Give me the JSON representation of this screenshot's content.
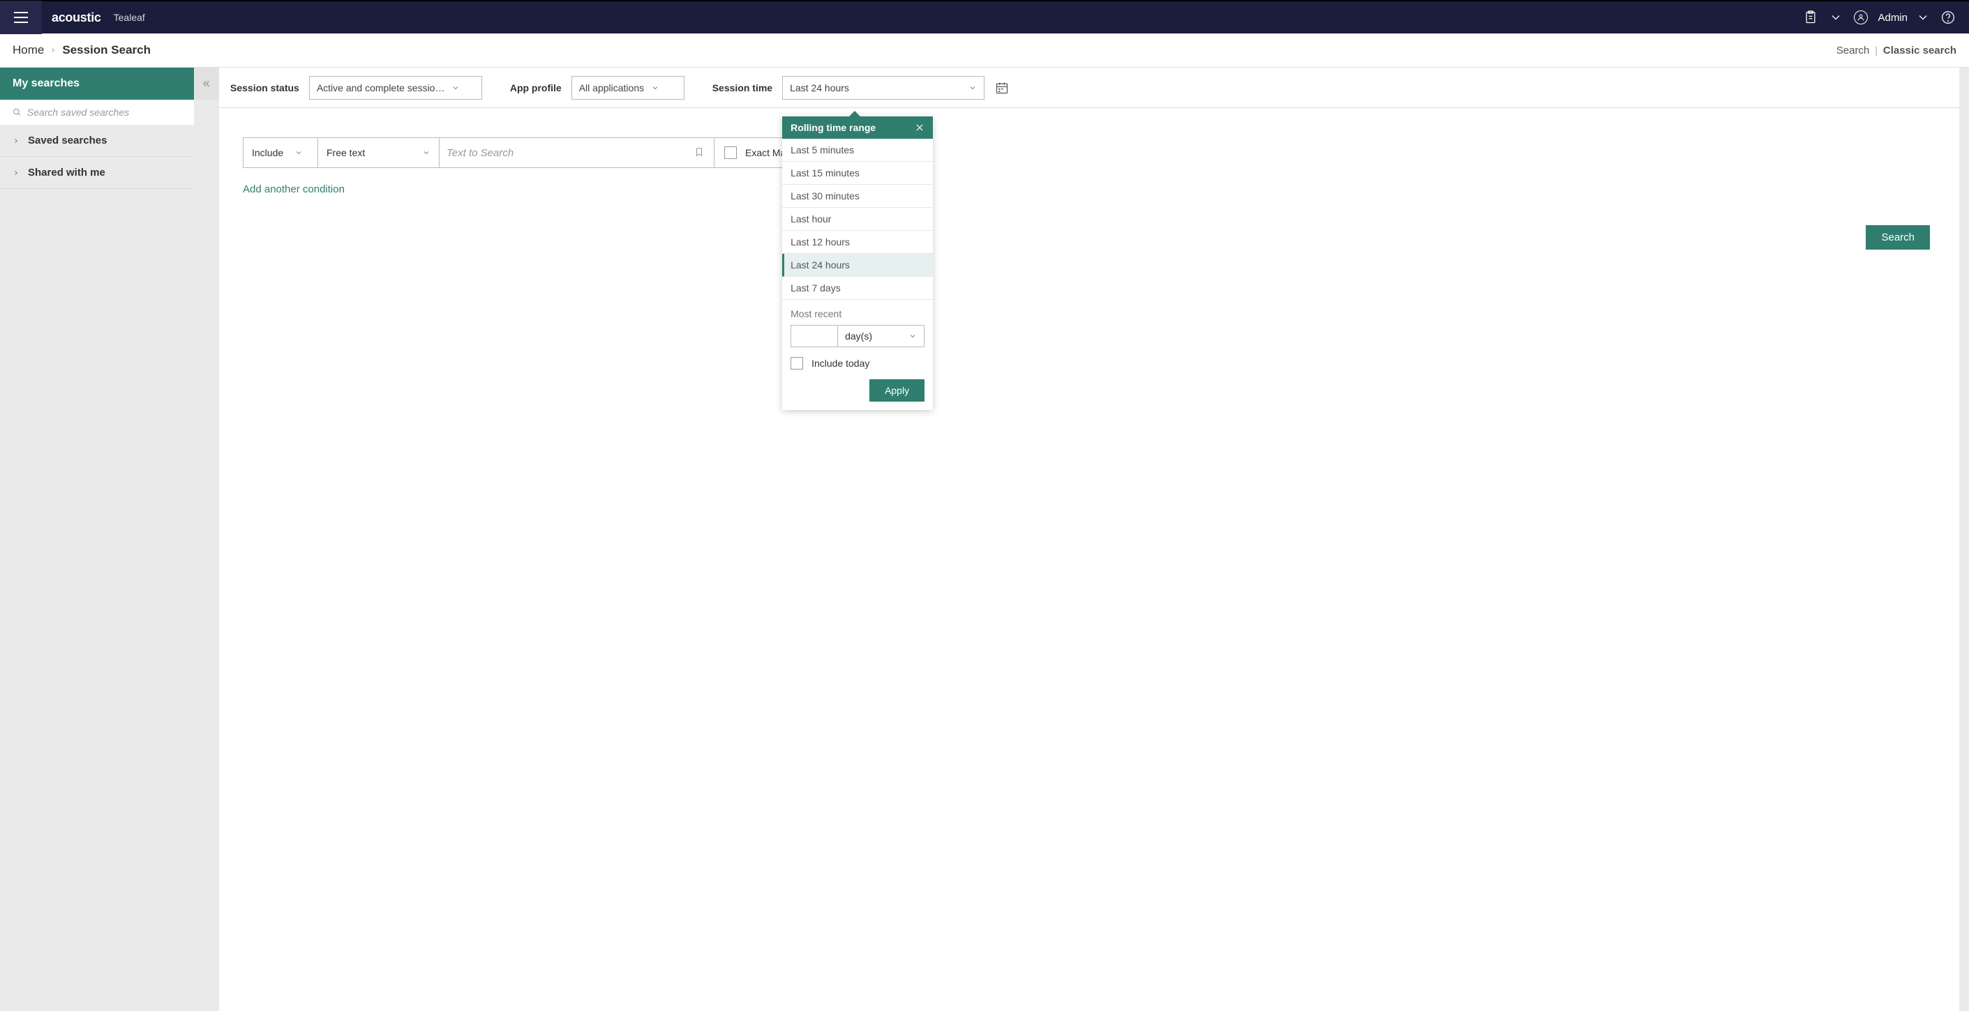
{
  "topnav": {
    "brand": "acoustic",
    "product": "Tealeaf",
    "admin_label": "Admin"
  },
  "breadcrumb": {
    "home": "Home",
    "current": "Session Search",
    "search_link": "Search",
    "classic_link": "Classic search"
  },
  "sidebar": {
    "header": "My searches",
    "search_placeholder": "Search saved searches",
    "saved": "Saved searches",
    "shared": "Shared with me"
  },
  "filters": {
    "status_label": "Session status",
    "status_value": "Active and complete sessio…",
    "app_label": "App profile",
    "app_value": "All applications",
    "time_label": "Session time",
    "time_value": "Last 24 hours"
  },
  "condition": {
    "include": "Include",
    "type": "Free text",
    "input_placeholder": "Text to Search",
    "exact_label": "Exact Match",
    "add_label": "Add another condition"
  },
  "search_button": "Search",
  "dropdown": {
    "title": "Rolling time range",
    "items": [
      "Last 5 minutes",
      "Last 15 minutes",
      "Last 30 minutes",
      "Last hour",
      "Last 12 hours",
      "Last 24 hours",
      "Last 7 days"
    ],
    "selected_index": 5,
    "most_recent_label": "Most recent",
    "unit_value": "day(s)",
    "include_today": "Include today",
    "apply": "Apply"
  }
}
